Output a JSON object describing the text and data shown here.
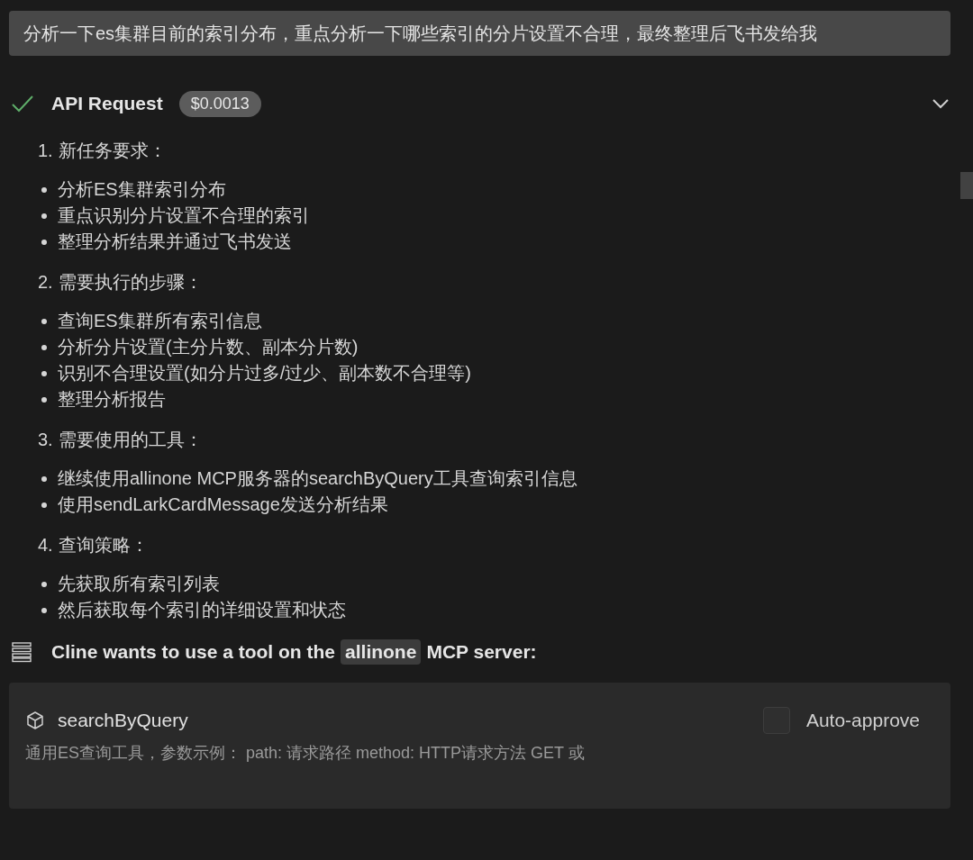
{
  "user_message": "分析一下es集群目前的索引分布，重点分析一下哪些索引的分片设置不合理，最终整理后飞书发给我",
  "api_request": {
    "title": "API Request",
    "cost": "$0.0013",
    "done": true
  },
  "sections": [
    {
      "number": "1.",
      "heading": "新任务要求：",
      "bullets": [
        "分析ES集群索引分布",
        "重点识别分片设置不合理的索引",
        "整理分析结果并通过飞书发送"
      ]
    },
    {
      "number": "2.",
      "heading": "需要执行的步骤：",
      "bullets": [
        "查询ES集群所有索引信息",
        "分析分片设置(主分片数、副本分片数)",
        "识别不合理设置(如分片过多/过少、副本数不合理等)",
        "整理分析报告"
      ]
    },
    {
      "number": "3.",
      "heading": "需要使用的工具：",
      "bullets": [
        "继续使用allinone MCP服务器的searchByQuery工具查询索引信息",
        "使用sendLarkCardMessage发送分析结果"
      ]
    },
    {
      "number": "4.",
      "heading": "查询策略：",
      "bullets": [
        "先获取所有索引列表",
        "然后获取每个索引的详细设置和状态"
      ]
    }
  ],
  "tool_request": {
    "prefix": "Cline wants to use a tool on the",
    "server": "allinone",
    "suffix": "MCP server:"
  },
  "tool_card": {
    "name": "searchByQuery",
    "auto_approve": {
      "label": "Auto-approve",
      "checked": false
    },
    "description": "通用ES查询工具，参数示例： path: 请求路径 method: HTTP请求方法 GET 或"
  }
}
